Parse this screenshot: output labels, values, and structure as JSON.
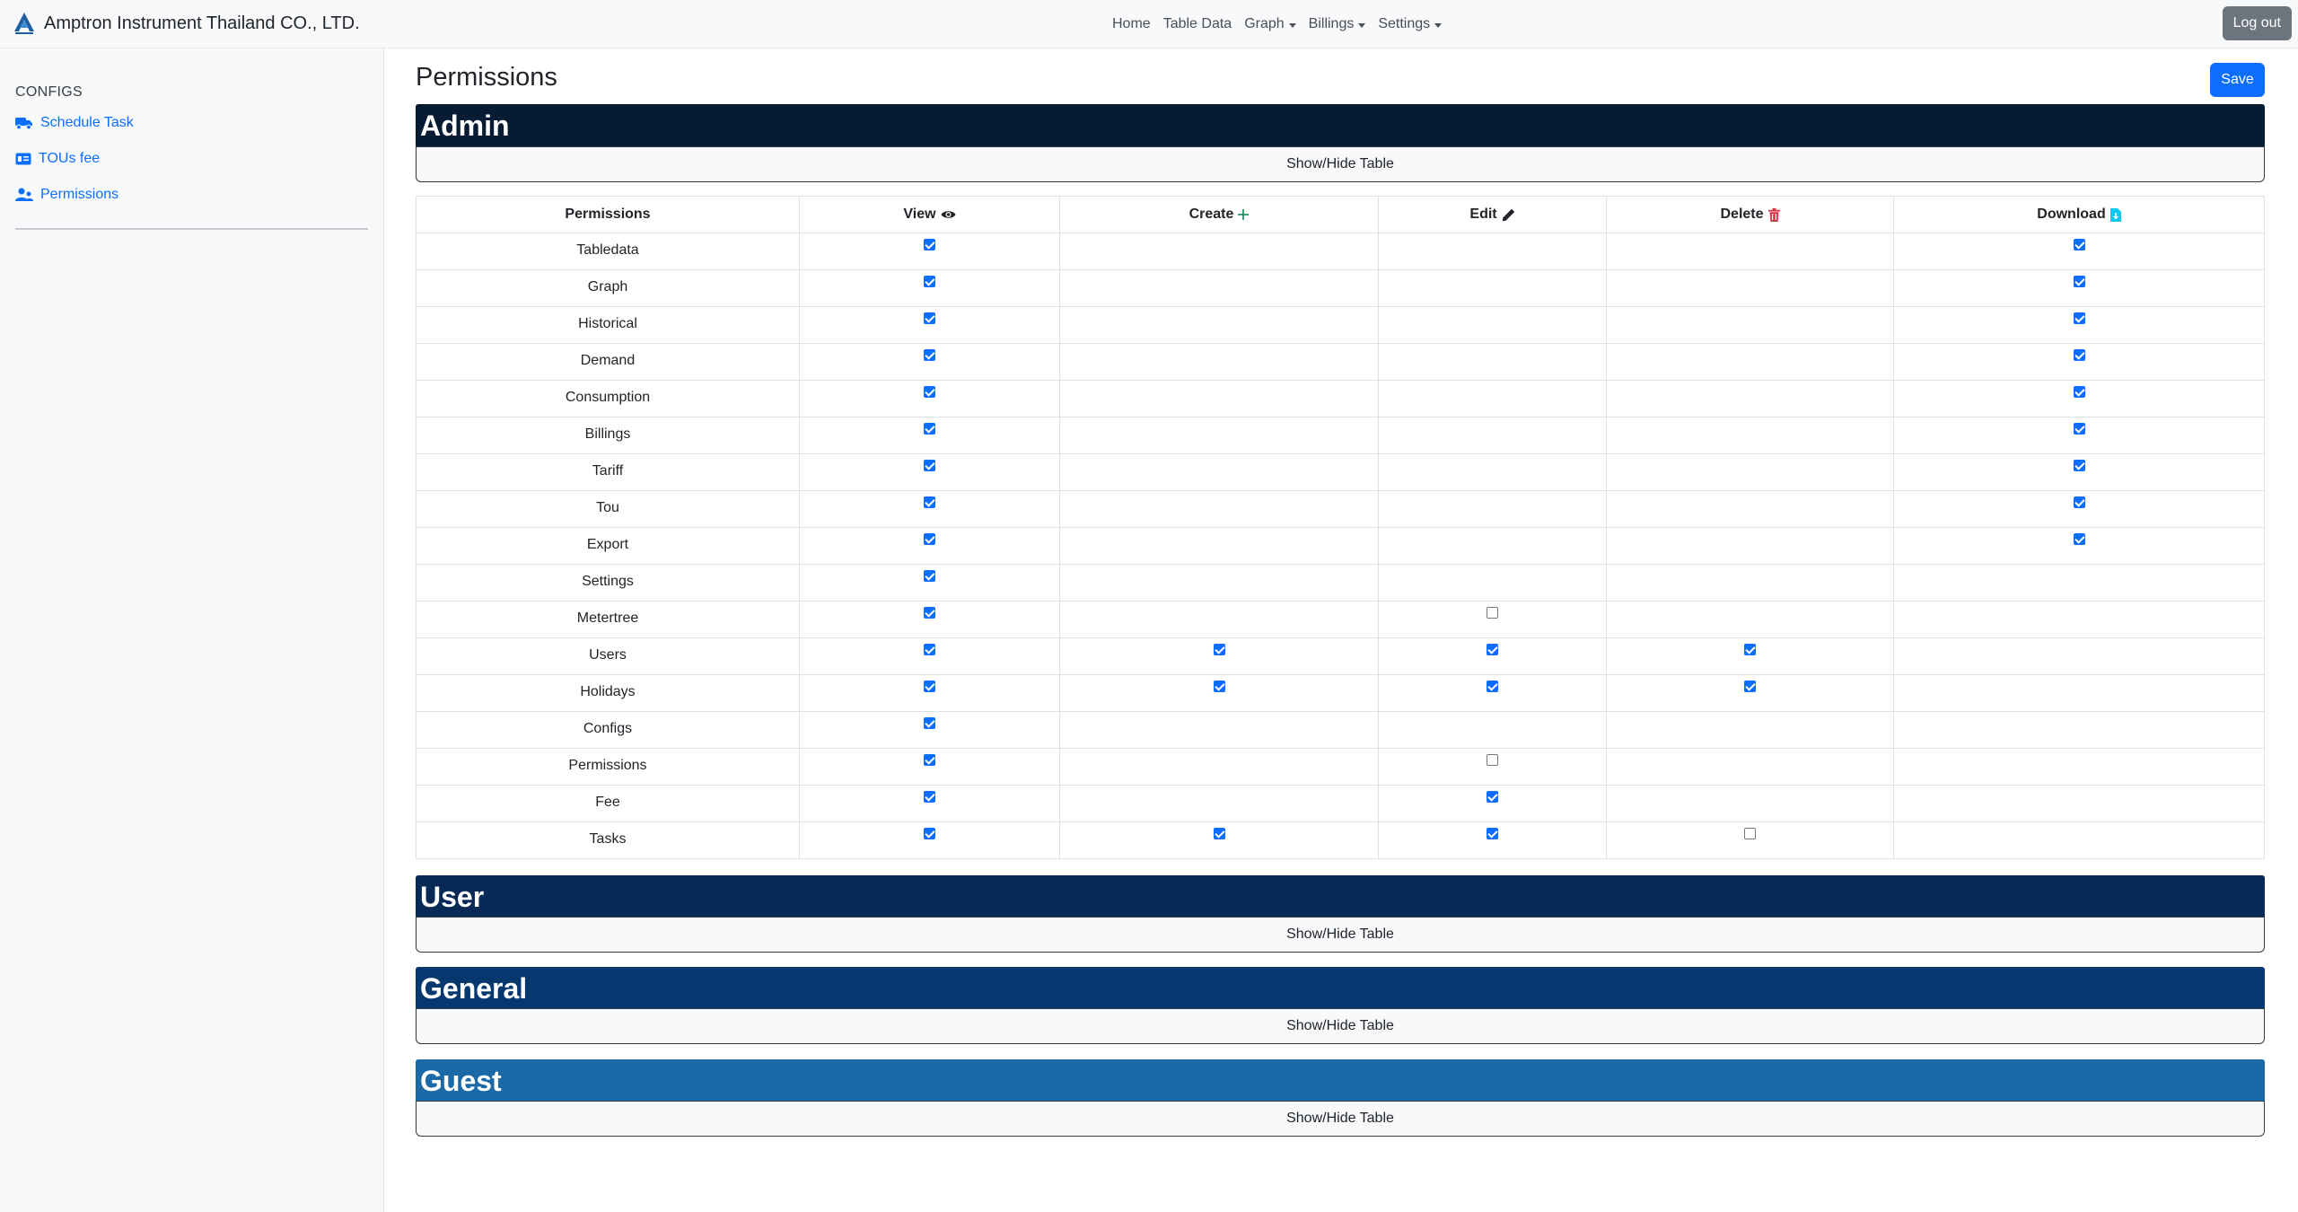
{
  "navbar": {
    "brand": "Amptron Instrument Thailand CO., LTD.",
    "links": [
      {
        "label": "Home",
        "dropdown": false
      },
      {
        "label": "Table Data",
        "dropdown": false
      },
      {
        "label": "Graph",
        "dropdown": true
      },
      {
        "label": "Billings",
        "dropdown": true
      },
      {
        "label": "Settings",
        "dropdown": true
      }
    ],
    "logout_label": "Log out"
  },
  "sidebar": {
    "heading": "CONFIGS",
    "items": [
      {
        "label": "Schedule Task",
        "icon": "truck-icon"
      },
      {
        "label": "TOUs fee",
        "icon": "card-icon"
      },
      {
        "label": "Permissions",
        "icon": "users-icon"
      }
    ]
  },
  "page": {
    "title": "Permissions",
    "save_label": "Save",
    "toggle_label": "Show/Hide Table"
  },
  "colors": {
    "accent": "#0d6efd",
    "admin": "#071b33",
    "user": "#062a55",
    "general": "#05386e",
    "guest": "#1b6aa7"
  },
  "groups": [
    {
      "name": "Admin",
      "color": "#071b33",
      "expanded": true
    },
    {
      "name": "User",
      "color": "#062a55",
      "expanded": false
    },
    {
      "name": "General",
      "color": "#05386e",
      "expanded": false
    },
    {
      "name": "Guest",
      "color": "#1b6aa7",
      "expanded": false
    }
  ],
  "table": {
    "headers": {
      "permissions": "Permissions",
      "view": "View",
      "create": "Create",
      "edit": "Edit",
      "delete": "Delete",
      "download": "Download"
    },
    "header_icons": {
      "view": "eye-icon",
      "create": "plus-icon",
      "edit": "pencil-icon",
      "delete": "trash-icon",
      "download": "file-download-icon"
    },
    "rows": [
      {
        "name": "Tabledata",
        "view": true,
        "create": null,
        "edit": null,
        "delete": null,
        "download": true
      },
      {
        "name": "Graph",
        "view": true,
        "create": null,
        "edit": null,
        "delete": null,
        "download": true
      },
      {
        "name": "Historical",
        "view": true,
        "create": null,
        "edit": null,
        "delete": null,
        "download": true
      },
      {
        "name": "Demand",
        "view": true,
        "create": null,
        "edit": null,
        "delete": null,
        "download": true
      },
      {
        "name": "Consumption",
        "view": true,
        "create": null,
        "edit": null,
        "delete": null,
        "download": true
      },
      {
        "name": "Billings",
        "view": true,
        "create": null,
        "edit": null,
        "delete": null,
        "download": true
      },
      {
        "name": "Tariff",
        "view": true,
        "create": null,
        "edit": null,
        "delete": null,
        "download": true
      },
      {
        "name": "Tou",
        "view": true,
        "create": null,
        "edit": null,
        "delete": null,
        "download": true
      },
      {
        "name": "Export",
        "view": true,
        "create": null,
        "edit": null,
        "delete": null,
        "download": true
      },
      {
        "name": "Settings",
        "view": true,
        "create": null,
        "edit": null,
        "delete": null,
        "download": null
      },
      {
        "name": "Metertree",
        "view": true,
        "create": null,
        "edit": false,
        "delete": null,
        "download": null
      },
      {
        "name": "Users",
        "view": true,
        "create": true,
        "edit": true,
        "delete": true,
        "download": null
      },
      {
        "name": "Holidays",
        "view": true,
        "create": true,
        "edit": true,
        "delete": true,
        "download": null
      },
      {
        "name": "Configs",
        "view": true,
        "create": null,
        "edit": null,
        "delete": null,
        "download": null
      },
      {
        "name": "Permissions",
        "view": true,
        "create": null,
        "edit": false,
        "delete": null,
        "download": null
      },
      {
        "name": "Fee",
        "view": true,
        "create": null,
        "edit": true,
        "delete": null,
        "download": null
      },
      {
        "name": "Tasks",
        "view": true,
        "create": true,
        "edit": true,
        "delete": false,
        "download": null
      }
    ]
  }
}
